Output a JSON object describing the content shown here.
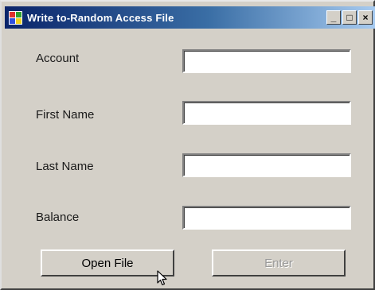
{
  "window": {
    "title": "Write to-Random Access File"
  },
  "title_controls": {
    "minimize_glyph": "_",
    "maximize_glyph": "□",
    "close_glyph": "×"
  },
  "form": {
    "fields": [
      {
        "label": "Account",
        "value": ""
      },
      {
        "label": "First Name",
        "value": ""
      },
      {
        "label": "Last Name",
        "value": ""
      },
      {
        "label": "Balance",
        "value": ""
      }
    ]
  },
  "buttons": {
    "open_file": "Open File",
    "enter": "Enter",
    "enter_enabled": false
  },
  "icons": {
    "app": "app-window-icon",
    "cursor": "mouse-pointer-icon"
  },
  "colors": {
    "title_gradient_start": "#0a246a",
    "title_gradient_end": "#a6caf0",
    "window_face": "#d4d0c8"
  }
}
